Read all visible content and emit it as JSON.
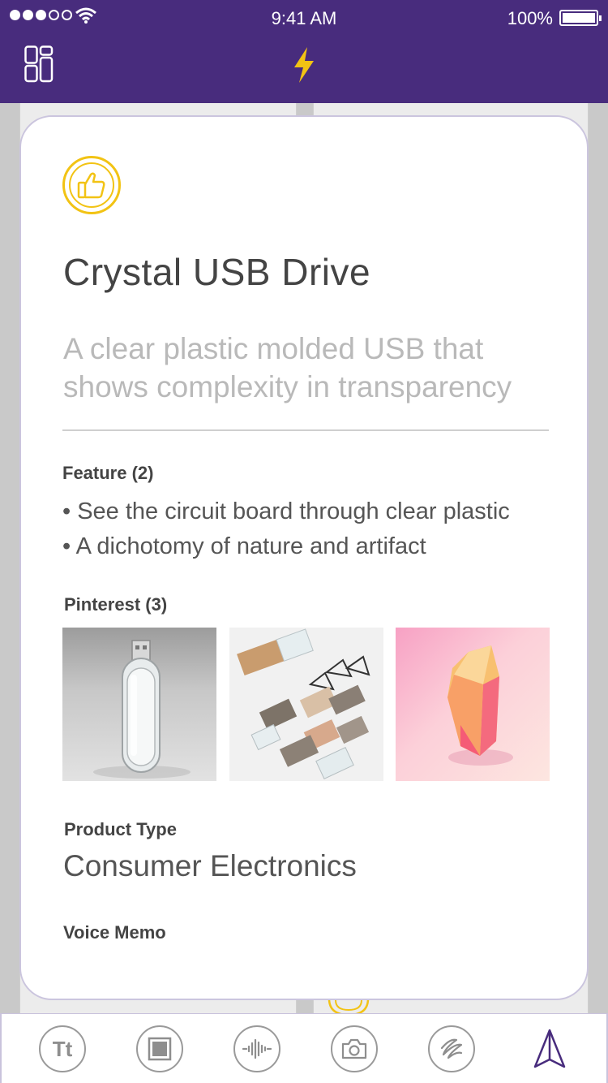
{
  "status_bar": {
    "time": "9:41 AM",
    "battery": "100%"
  },
  "nav": {
    "left_icon": "dashboard-grid-icon",
    "center_icon": "lightning-bolt-icon",
    "accent": "#482c7d",
    "bolt_color": "#f2c314"
  },
  "card": {
    "badge_icon": "thumbs-up-icon",
    "title": "Crystal USB Drive",
    "subtitle": "A clear plastic molded USB that shows complexity in transparency",
    "feature_label": "Feature (2)",
    "features": [
      "• See the circuit board through clear plastic",
      "• A dichotomy of nature and artifact"
    ],
    "pinterest_label": "Pinterest (3)",
    "pins": [
      "clear-usb-stick-photo",
      "wood-and-acrylic-usb-set-photo",
      "pink-crystal-photo"
    ],
    "product_type_label": "Product Type",
    "product_type_value": "Consumer Electronics",
    "voice_memo_label": "Voice Memo"
  },
  "toolbar": {
    "text_tool": "Tt",
    "icons": [
      "text-tool-icon",
      "frame-tool-icon",
      "audio-wave-icon",
      "camera-icon",
      "scribble-icon",
      "send-icon"
    ]
  }
}
